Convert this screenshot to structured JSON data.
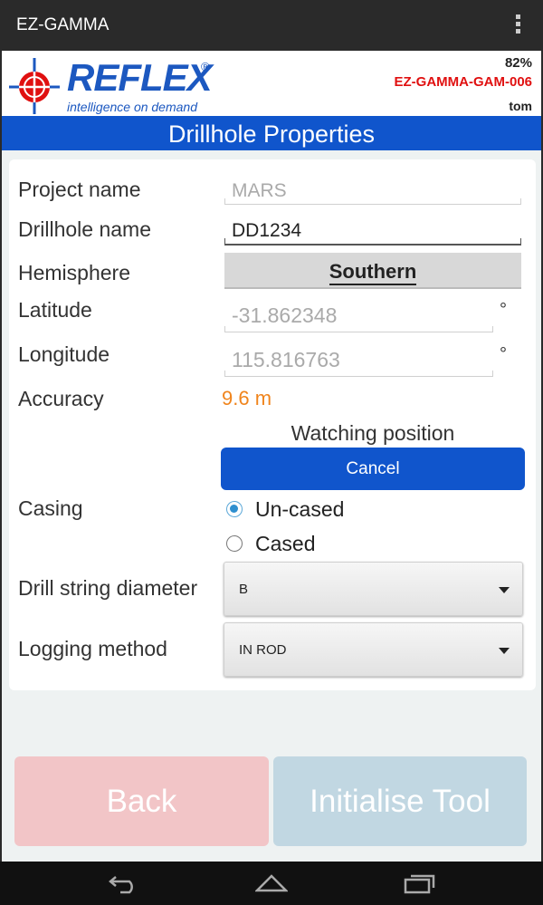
{
  "titlebar": {
    "app_title": "EZ-GAMMA",
    "menu_icon": "overflow-menu-icon"
  },
  "header": {
    "logo_text": "REFLEX",
    "logo_reg": "®",
    "logo_tagline": "intelligence on demand",
    "battery": "82%",
    "device_id": "EZ-GAMMA-GAM-006",
    "user": "tom",
    "colors": {
      "brand_blue": "#1c58c0",
      "device_red": "#e01010"
    }
  },
  "page_title": "Drillhole Properties",
  "form": {
    "project_name": {
      "label": "Project name",
      "value": "MARS"
    },
    "drillhole_name": {
      "label": "Drillhole name",
      "value": "DD1234"
    },
    "hemisphere": {
      "label": "Hemisphere",
      "value": "Southern"
    },
    "latitude": {
      "label": "Latitude",
      "value": "-31.862348",
      "unit": "°"
    },
    "longitude": {
      "label": "Longitude",
      "value": "115.816763",
      "unit": "°"
    },
    "accuracy": {
      "label": "Accuracy",
      "value": "9.6 m",
      "color": "#f0841c"
    },
    "watching_text": "Watching position",
    "cancel_label": "Cancel",
    "casing": {
      "label": "Casing",
      "options": [
        {
          "label": "Un-cased",
          "selected": true
        },
        {
          "label": "Cased",
          "selected": false
        }
      ]
    },
    "drill_string_diameter": {
      "label": "Drill string diameter",
      "value": "B"
    },
    "logging_method": {
      "label": "Logging method",
      "value": "IN ROD"
    }
  },
  "buttons": {
    "back_label": "Back",
    "init_label": "Initialise Tool"
  },
  "navbar": {
    "back_icon": "nav-back-icon",
    "home_icon": "nav-home-icon",
    "recents_icon": "nav-recents-icon"
  }
}
